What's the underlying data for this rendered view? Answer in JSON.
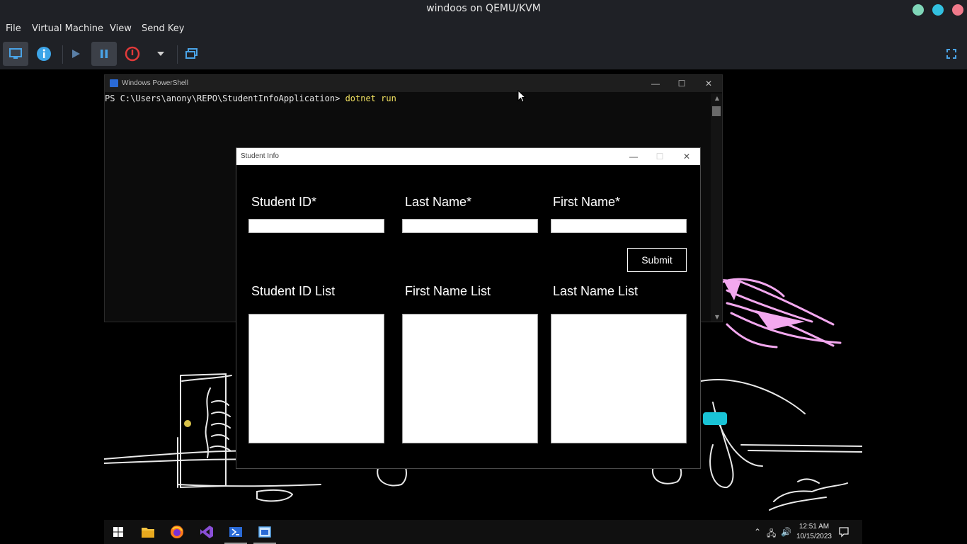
{
  "host": {
    "title": "windoos on QEMU/KVM",
    "menu": [
      "File",
      "Virtual Machine",
      "View",
      "Send Key"
    ],
    "toolbar": {
      "buttons": [
        {
          "name": "console-icon"
        },
        {
          "name": "info-icon"
        },
        {
          "name": "play-icon"
        },
        {
          "name": "pause-icon"
        },
        {
          "name": "power-icon"
        },
        {
          "name": "dropdown-icon"
        },
        {
          "name": "snapshot-icon"
        },
        {
          "name": "fullscreen-icon"
        }
      ]
    }
  },
  "guest": {
    "powershell": {
      "title": "Windows PowerShell",
      "prompt": "PS C:\\Users\\anony\\REPO\\StudentInfoApplication> ",
      "command": "dotnet run"
    },
    "student_info": {
      "title": "Student Info",
      "labels": {
        "student_id": "Student ID*",
        "last_name": "Last Name*",
        "first_name": "First Name*",
        "student_id_list": "Student ID List",
        "first_name_list": "First Name List",
        "last_name_list": "Last Name List"
      },
      "inputs": {
        "student_id": "",
        "last_name": "",
        "first_name": ""
      },
      "submit_label": "Submit"
    },
    "taskbar": {
      "apps": [
        "start-icon",
        "file-explorer-icon",
        "firefox-icon",
        "visual-studio-icon",
        "powershell-icon",
        "student-info-app-icon"
      ],
      "time": "12:51 AM",
      "date": "10/15/2023"
    }
  },
  "colors": {
    "host_bg": "#1f2126",
    "guest_bg": "#000000",
    "ps_bg": "#0c0c0c",
    "ps_command": "#f0e060",
    "sketch_pink": "#f3a8ef",
    "sketch_cyan": "#19c3d6",
    "taskbar_bg": "#101010"
  }
}
